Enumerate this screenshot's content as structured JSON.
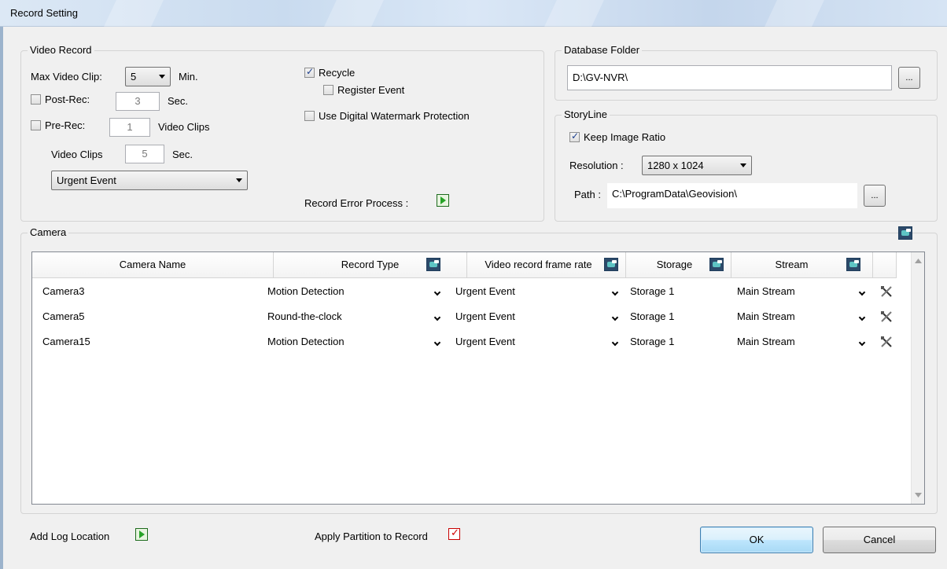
{
  "window": {
    "title": "Record Setting"
  },
  "video_record": {
    "legend": "Video Record",
    "max_clip_label": "Max Video Clip:",
    "max_clip_value": "5",
    "max_clip_unit": "Min.",
    "post_rec_label": "Post-Rec:",
    "post_rec_value": "3",
    "post_rec_unit": "Sec.",
    "pre_rec_label": "Pre-Rec:",
    "pre_rec_value": "1",
    "pre_rec_unit": "Video Clips",
    "video_clips_label": "Video Clips",
    "video_clips_value": "5",
    "video_clips_unit": "Sec.",
    "event_type": "Urgent Event",
    "recycle_label": "Recycle",
    "register_event_label": "Register Event",
    "watermark_label": "Use Digital Watermark Protection",
    "error_process_label": "Record Error Process :"
  },
  "database": {
    "legend": "Database Folder",
    "path": "D:\\GV-NVR\\",
    "browse_label": "..."
  },
  "storyline": {
    "legend": "StoryLine",
    "keep_ratio_label": "Keep Image Ratio",
    "resolution_label": "Resolution :",
    "resolution_value": "1280 x 1024",
    "path_label": "Path :",
    "path_value": "C:\\ProgramData\\Geovision\\",
    "browse_label": "..."
  },
  "camera": {
    "legend": "Camera",
    "columns": [
      "Camera Name",
      "Record Type",
      "Video record frame rate",
      "Storage",
      "Stream"
    ],
    "rows": [
      {
        "name": "Camera3",
        "record_type": "Motion Detection",
        "frame_rate": "Urgent Event",
        "storage": "Storage 1",
        "stream": "Main Stream"
      },
      {
        "name": "Camera5",
        "record_type": "Round-the-clock",
        "frame_rate": "Urgent Event",
        "storage": "Storage 1",
        "stream": "Main Stream"
      },
      {
        "name": "Camera15",
        "record_type": "Motion Detection",
        "frame_rate": "Urgent Event",
        "storage": "Storage 1",
        "stream": "Main Stream"
      }
    ]
  },
  "footer": {
    "add_log_label": "Add Log Location",
    "apply_partition_label": "Apply Partition to Record",
    "ok_label": "OK",
    "cancel_label": "Cancel"
  }
}
